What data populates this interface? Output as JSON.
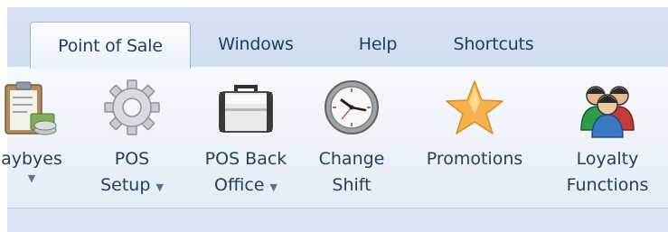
{
  "tabs": [
    {
      "label": "Point of Sale",
      "active": true
    },
    {
      "label": "Windows",
      "active": false
    },
    {
      "label": "Help",
      "active": false
    },
    {
      "label": "Shortcuts",
      "active": false
    }
  ],
  "ribbon": {
    "laybyes": {
      "label": "aybyes",
      "icon": "clipboard-money-icon",
      "dropdown_arrow": "▼"
    },
    "pos_setup": {
      "line1": "POS",
      "line2": "Setup",
      "icon": "gear-icon",
      "dropdown_arrow": "▼"
    },
    "pos_back_office": {
      "line1": "POS Back",
      "line2": "Office",
      "icon": "briefcase-icon",
      "dropdown_arrow": "▼"
    },
    "change_shift": {
      "line1": "Change",
      "line2": "Shift",
      "icon": "clock-icon"
    },
    "promotions": {
      "line1": "Promotions",
      "icon": "star-icon"
    },
    "loyalty_functions": {
      "line1": "Loyalty",
      "line2": "Functions",
      "icon": "people-group-icon"
    }
  },
  "colors": {
    "tab_text": "#1e3d68",
    "ribbon_bg": "#eef3fa",
    "app_bg": "#dbe6f4"
  }
}
